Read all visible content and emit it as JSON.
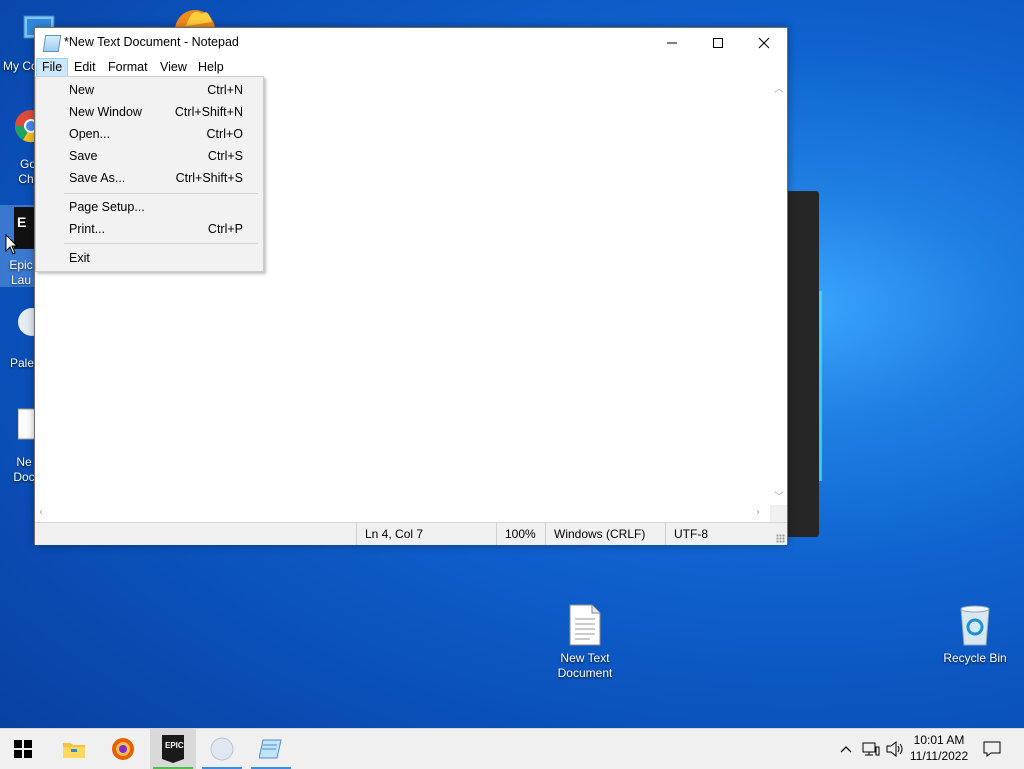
{
  "desktop": {
    "left_icons": [
      {
        "label": "My Co",
        "icon": "computer-icon"
      },
      {
        "label": "Go\nChr",
        "icon": "chrome-icon"
      },
      {
        "label": "Epic\nLau",
        "icon": "epic-games-icon"
      },
      {
        "label": "Pale",
        "icon": "pale-moon-icon"
      },
      {
        "label": "Ne\nDoc",
        "icon": "text-file-icon"
      }
    ],
    "new_text_document": "New Text\nDocument",
    "recycle_bin": "Recycle Bin"
  },
  "notepad": {
    "title": "*New Text Document - Notepad",
    "minimize": "—",
    "maximize": "☐",
    "close": "✕",
    "menu": [
      "File",
      "Edit",
      "Format",
      "View",
      "Help"
    ],
    "content": "",
    "status": {
      "position": "Ln 4, Col 7",
      "zoom": "100%",
      "line_ending": "Windows (CRLF)",
      "encoding": "UTF-8"
    }
  },
  "file_menu": {
    "items": [
      {
        "label": "New",
        "shortcut": "Ctrl+N"
      },
      {
        "label": "New Window",
        "shortcut": "Ctrl+Shift+N"
      },
      {
        "label": "Open...",
        "shortcut": "Ctrl+O"
      },
      {
        "label": "Save",
        "shortcut": "Ctrl+S"
      },
      {
        "label": "Save As...",
        "shortcut": "Ctrl+Shift+S"
      },
      {
        "label": "Page Setup...",
        "shortcut": ""
      },
      {
        "label": "Print...",
        "shortcut": "Ctrl+P"
      },
      {
        "label": "Exit",
        "shortcut": ""
      }
    ]
  },
  "taskbar": {
    "apps": [
      "start-icon",
      "file-explorer-icon",
      "firefox-icon",
      "epic-games-icon",
      "pale-moon-icon",
      "notepad-icon"
    ],
    "active_app": "epic-games-icon",
    "epic_label": "EPIC",
    "time": "10:01 AM",
    "date": "11/11/2022"
  },
  "colors": {
    "desktop": "#0a58c4",
    "menu_highlight": "#cce8ff",
    "taskbar": "#f0f0f0"
  }
}
